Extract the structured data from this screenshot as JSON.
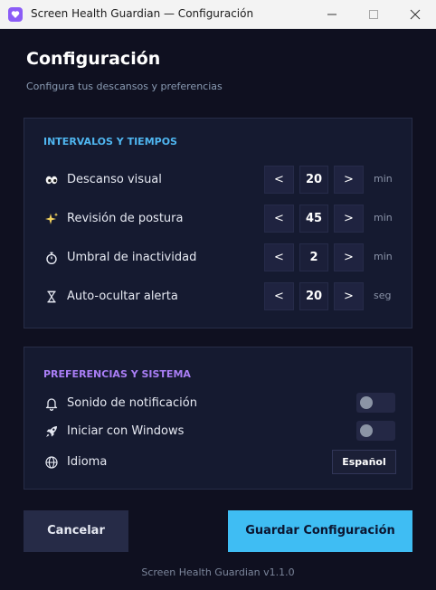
{
  "window": {
    "title": "Screen Health Guardian — Configuración",
    "app_icon": "heart-shield-icon",
    "controls": [
      "minimize-icon",
      "maximize-icon",
      "close-icon"
    ]
  },
  "header": {
    "title": "Configuración",
    "subtitle": "Configura tus descansos y preferencias"
  },
  "intervals": {
    "title": "INTERVALOS Y TIEMPOS",
    "rows": [
      {
        "icon": "eyes-icon",
        "label": "Descanso visual",
        "dec": "<",
        "value": "20",
        "inc": ">",
        "unit": "min"
      },
      {
        "icon": "sparkles-icon",
        "label": "Revisión de postura",
        "dec": "<",
        "value": "45",
        "inc": ">",
        "unit": "min"
      },
      {
        "icon": "stopwatch-icon",
        "label": "Umbral de inactividad",
        "dec": "<",
        "value": "2",
        "inc": ">",
        "unit": "min"
      },
      {
        "icon": "hourglass-icon",
        "label": "Auto-ocultar alerta",
        "dec": "<",
        "value": "20",
        "inc": ">",
        "unit": "seg"
      }
    ]
  },
  "preferences": {
    "title": "PREFERENCIAS Y SISTEMA",
    "sound": {
      "icon": "bell-icon",
      "label": "Sonido de notificación",
      "enabled": false
    },
    "startup": {
      "icon": "rocket-icon",
      "label": "Iniciar con Windows",
      "enabled": false
    },
    "language": {
      "icon": "globe-icon",
      "label": "Idioma",
      "value": "Español"
    }
  },
  "footer": {
    "cancel_label": "Cancelar",
    "save_label": "Guardar Configuración",
    "version": "Screen Health Guardian v1.1.0"
  },
  "colors": {
    "background": "#0f1020",
    "panel": "#151a30",
    "accent_blue": "#3fbdf3",
    "accent_purple": "#a97ef5"
  }
}
